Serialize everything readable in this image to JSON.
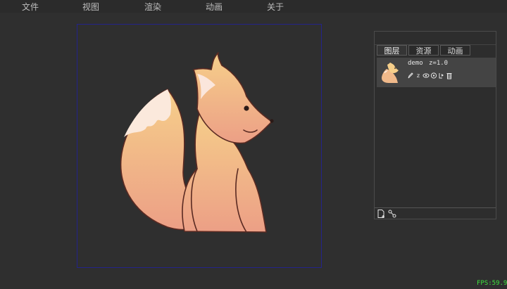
{
  "menu": [
    {
      "label": "文件"
    },
    {
      "label": "视图"
    },
    {
      "label": "渲染"
    },
    {
      "label": "动画"
    },
    {
      "label": "关于"
    }
  ],
  "panel": {
    "tabs": [
      {
        "label": "图层"
      },
      {
        "label": "资源"
      },
      {
        "label": "动画"
      }
    ],
    "active_tab": "图层",
    "layer": {
      "name": "demo",
      "z_label": "z=1.0",
      "tools": [
        "pencil-icon",
        "z-order-icon",
        "eye-icon",
        "target-icon",
        "rig-icon",
        "trash-icon"
      ],
      "z_tool_text": "z"
    },
    "bottom_buttons": [
      "new-layer-icon",
      "link-icon"
    ]
  },
  "status": {
    "fps": "FPS:59.94"
  },
  "colors": {
    "frame_border": "#23238a",
    "fps_text": "#3ee33e",
    "fox_top": "#f6cf8a",
    "fox_bottom": "#ec9f86"
  }
}
